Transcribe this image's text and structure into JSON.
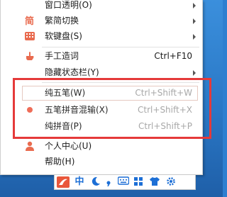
{
  "menu": {
    "items": [
      {
        "label": "窗口透明(O)",
        "shortcut": "",
        "has_submenu": true
      },
      {
        "label": "繁简切换",
        "shortcut": "",
        "has_submenu": true
      },
      {
        "label": "软键盘(S)",
        "shortcut": "",
        "has_submenu": true
      },
      {
        "label": "手工造词",
        "shortcut": "Ctrl+F10",
        "has_submenu": false
      },
      {
        "label": "隐藏状态栏(Y)",
        "shortcut": "",
        "has_submenu": true
      },
      {
        "label": "纯五笔(W)",
        "shortcut": "Ctrl+Shift+W",
        "has_submenu": false
      },
      {
        "label": "五笔拼音混输(X)",
        "shortcut": "Ctrl+Shift+X",
        "has_submenu": false,
        "selected": true
      },
      {
        "label": "纯拼音(P)",
        "shortcut": "Ctrl+Shift+P",
        "has_submenu": false
      },
      {
        "label": "个人中心(U)",
        "shortcut": "",
        "has_submenu": false
      },
      {
        "label": "帮助(H)",
        "shortcut": "",
        "has_submenu": false
      }
    ]
  },
  "imebar": {
    "mode_char": "中",
    "icons": [
      "ime-logo-icon",
      "moon-icon",
      "comma-icon",
      "keyboard-icon",
      "grid-icon",
      "shirt-icon",
      "gear-icon"
    ]
  },
  "colors": {
    "accent": "#e96b4f",
    "highlight_box": "#e53a3a",
    "ime_blue": "#1d6fd6"
  }
}
